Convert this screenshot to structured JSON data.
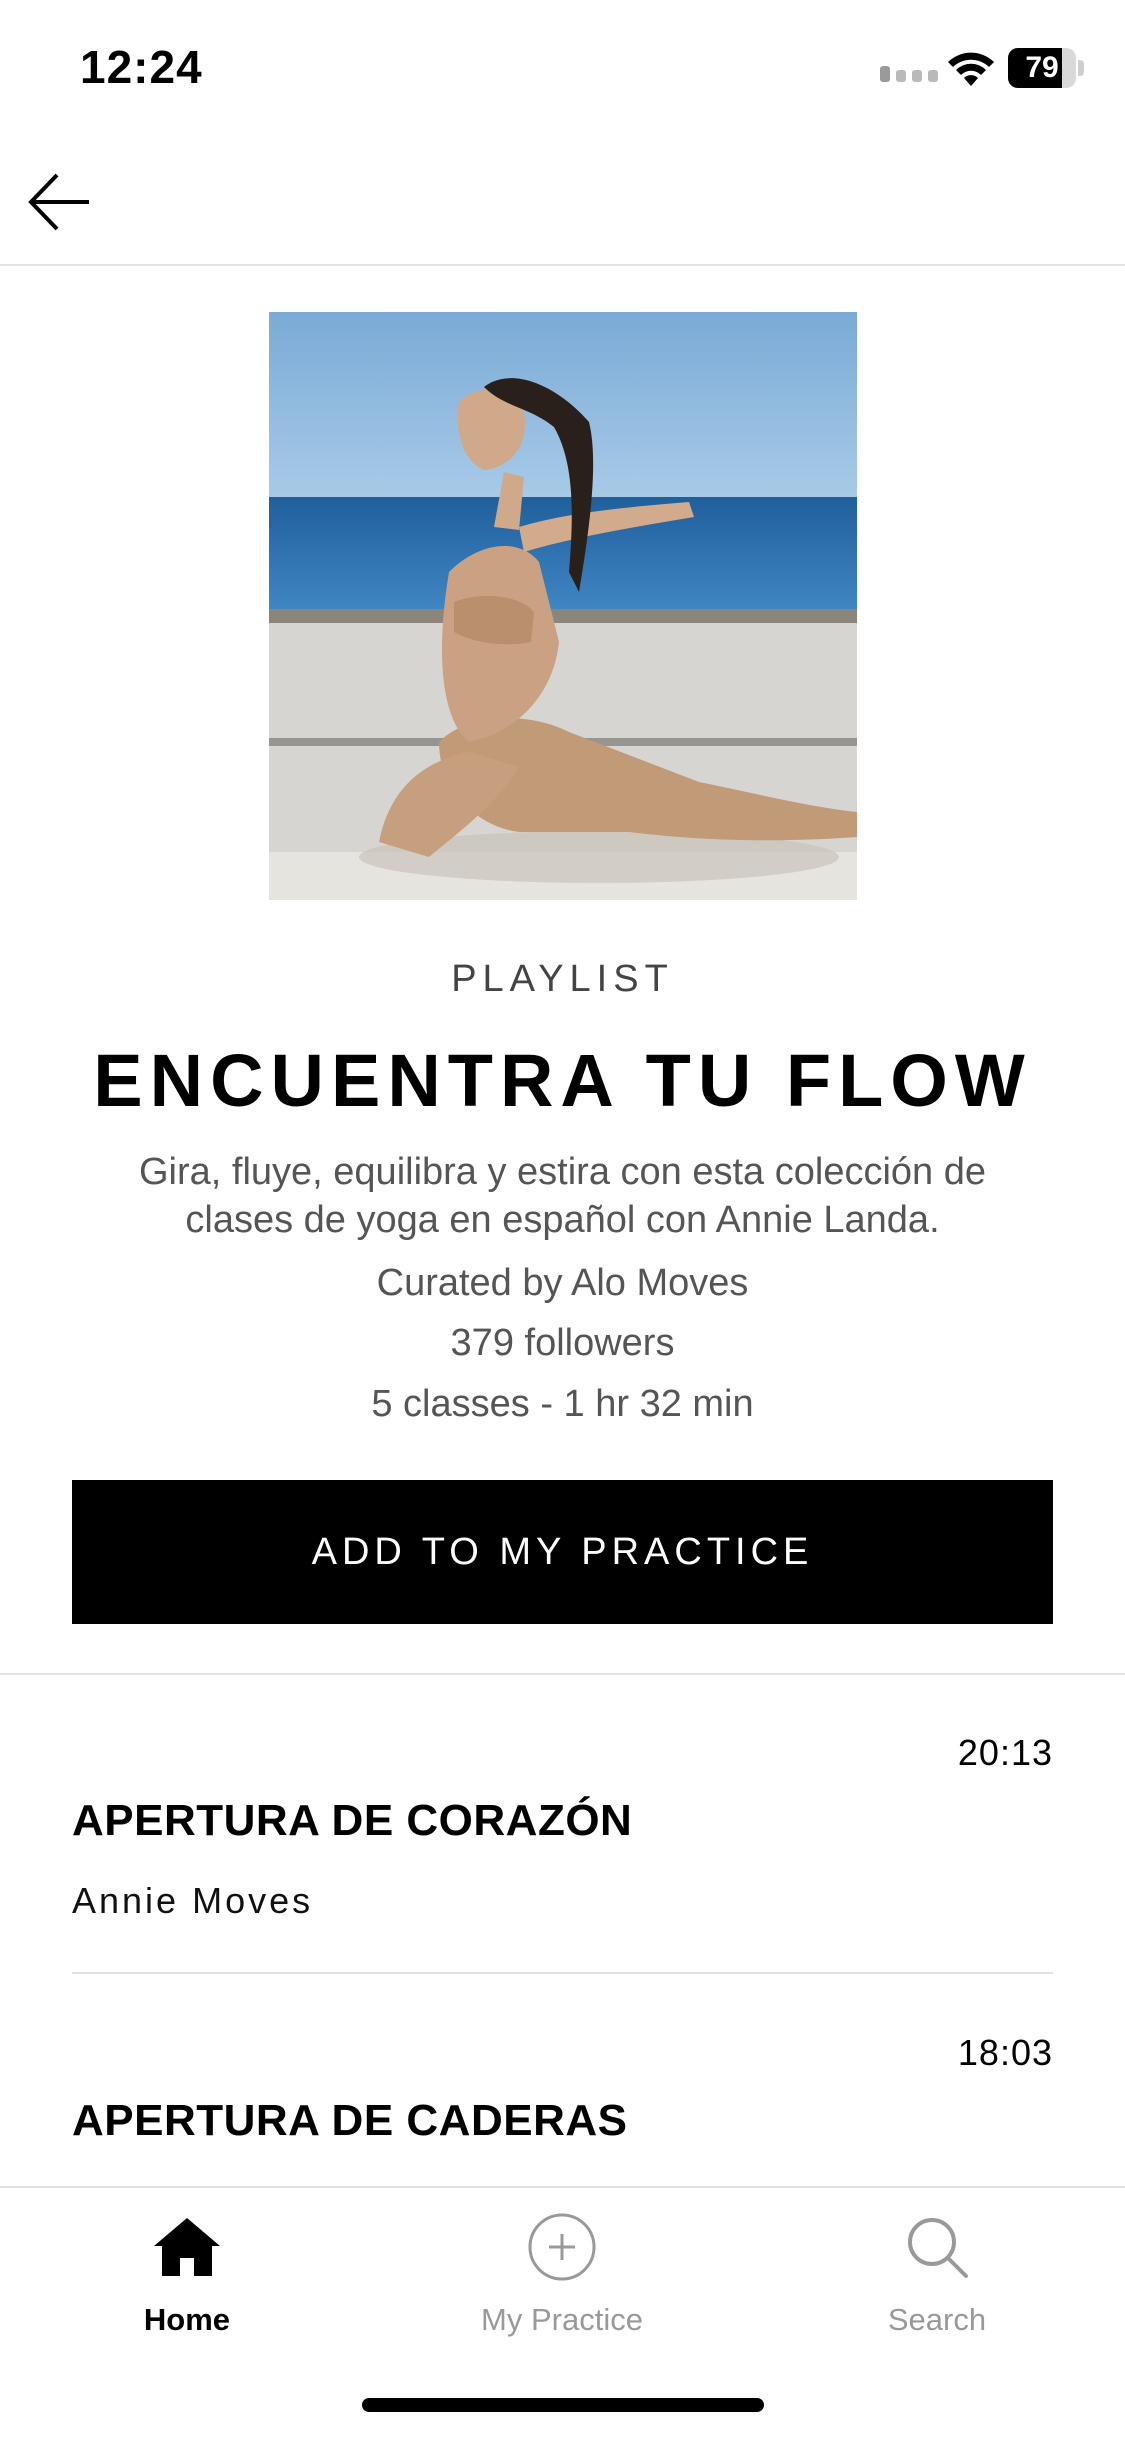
{
  "status_bar": {
    "time": "12:24",
    "battery_level": "79",
    "battery_fraction": 0.79,
    "icons": [
      "cellular-signal-icon",
      "wifi-icon",
      "battery-icon"
    ]
  },
  "nav": {
    "back_icon": "arrow-left-icon"
  },
  "playlist": {
    "label": "PLAYLIST",
    "title": "ENCUENTRA TU FLOW",
    "description": "Gira, fluye, equilibra y estira con esta colección de clases de yoga en español con Annie Landa.",
    "curated_by": "Curated by Alo Moves",
    "followers": "379 followers",
    "summary": "5 classes - 1 hr 32 min",
    "add_button_label": "ADD TO MY PRACTICE"
  },
  "classes": [
    {
      "duration": "20:13",
      "title": "APERTURA DE CORAZÓN",
      "instructor": "Annie Moves"
    },
    {
      "duration": "18:03",
      "title": "APERTURA DE CADERAS",
      "instructor": ""
    }
  ],
  "tab_bar": {
    "tabs": [
      {
        "label": "Home",
        "icon": "home-icon",
        "active": true
      },
      {
        "label": "My Practice",
        "icon": "plus-circle-icon",
        "active": false
      },
      {
        "label": "Search",
        "icon": "search-icon",
        "active": false
      }
    ]
  },
  "colors": {
    "accent": "#000000",
    "background": "#ffffff",
    "inactive_tab": "#999999",
    "secondary_text": "#555555"
  }
}
